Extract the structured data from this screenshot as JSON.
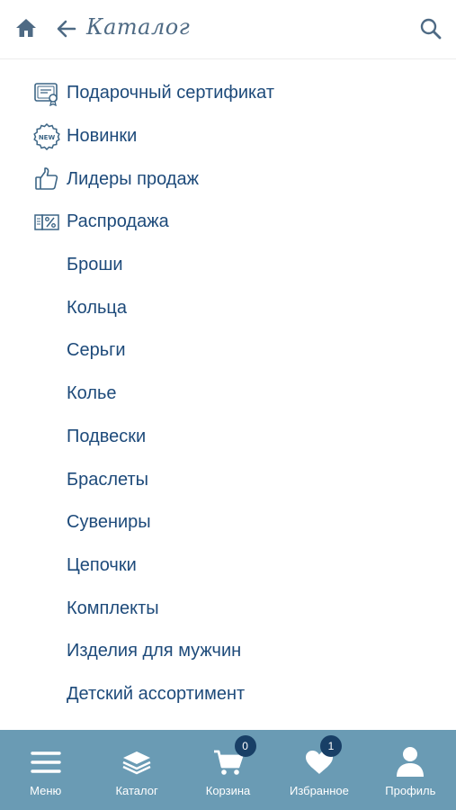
{
  "header": {
    "title": "Каталог",
    "home_icon": "home-icon",
    "back_icon": "arrow-left-icon",
    "search_icon": "search-icon"
  },
  "colors": {
    "accent": "#4e6a84",
    "link": "#1d4a7a",
    "tabbar": "#6a9bb4",
    "badge": "#183f66"
  },
  "catalog": {
    "items": [
      {
        "label": "Подарочный сертификат",
        "icon": "gift-certificate-icon"
      },
      {
        "label": "Новинки",
        "icon": "new-badge-icon"
      },
      {
        "label": "Лидеры продаж",
        "icon": "thumbs-up-icon"
      },
      {
        "label": "Распродажа",
        "icon": "sale-percent-icon"
      },
      {
        "label": "Броши"
      },
      {
        "label": "Кольца"
      },
      {
        "label": "Серьги"
      },
      {
        "label": "Колье"
      },
      {
        "label": "Подвески"
      },
      {
        "label": "Браслеты"
      },
      {
        "label": "Сувениры"
      },
      {
        "label": "Цепочки"
      },
      {
        "label": "Комплекты"
      },
      {
        "label": "Изделия для мужчин"
      },
      {
        "label": "Детский ассортимент"
      }
    ]
  },
  "tabbar": {
    "tabs": [
      {
        "label": "Меню",
        "icon": "hamburger-icon"
      },
      {
        "label": "Каталог",
        "icon": "layers-icon"
      },
      {
        "label": "Корзина",
        "icon": "cart-icon",
        "badge": "0"
      },
      {
        "label": "Избранное",
        "icon": "heart-icon",
        "badge": "1"
      },
      {
        "label": "Профиль",
        "icon": "user-icon"
      }
    ]
  }
}
